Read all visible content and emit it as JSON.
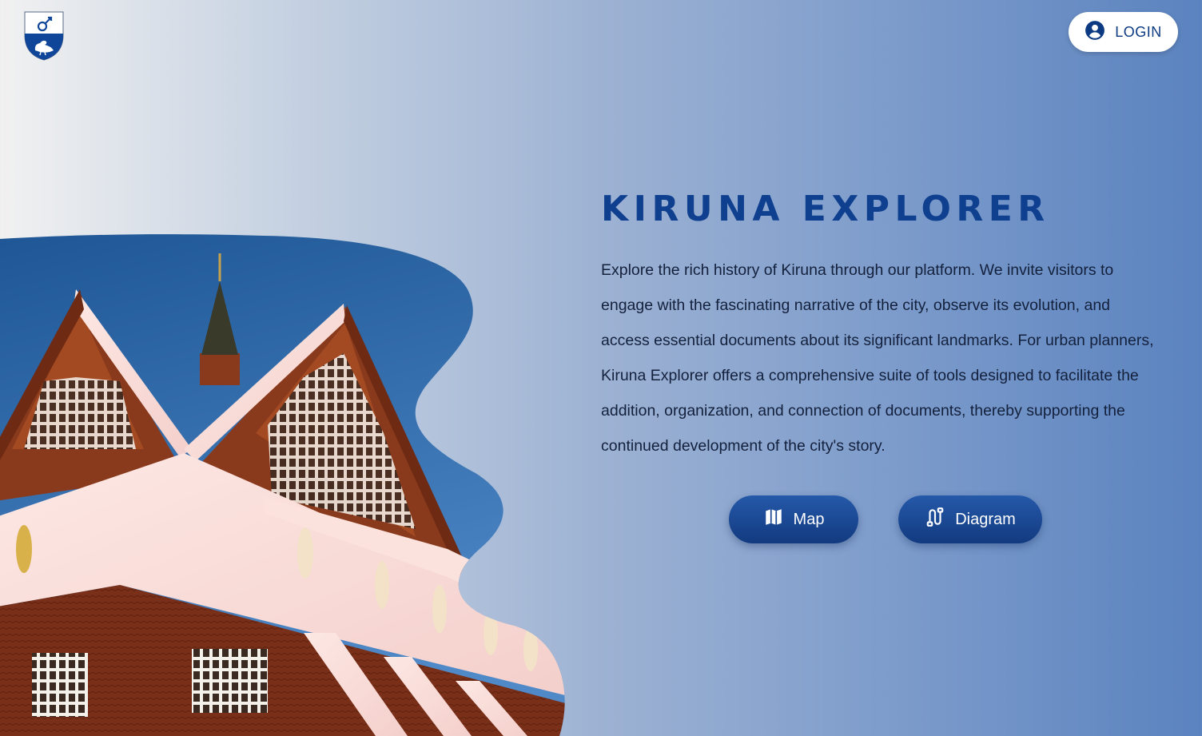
{
  "header": {
    "login_label": "LOGIN",
    "login_icon": "account-circle-icon",
    "logo_icon": "kiruna-coat-of-arms-icon"
  },
  "hero": {
    "title": "KIRUNA EXPLORER",
    "description": "Explore the rich history of Kiruna through our platform. We invite visitors to engage with the fascinating narrative of the city, observe its evolution, and access essential documents about its significant landmarks. For urban planners, Kiruna Explorer offers a comprehensive suite of tools designed to facilitate the addition, organization, and connection of documents, thereby supporting the continued development of the city's story.",
    "image_subject": "kiruna-church-photo"
  },
  "actions": {
    "map_label": "Map",
    "map_icon": "map-icon",
    "diagram_label": "Diagram",
    "diagram_icon": "diagram-icon"
  },
  "colors": {
    "accent": "#0f3f8f",
    "button": "#1a4791",
    "text": "#14213d"
  }
}
